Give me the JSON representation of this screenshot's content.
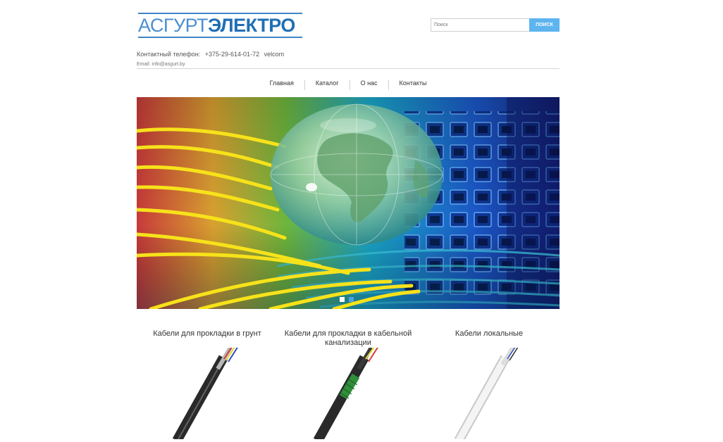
{
  "logo": {
    "part1": "АСГУРТ",
    "part2": "ЭЛЕКТРО"
  },
  "search": {
    "placeholder": "Поиск",
    "button": "ПОИСК"
  },
  "contacts": {
    "phone_label": "Контактный телефон:",
    "phone": "+375-29-614-01-72",
    "operator": "velcom",
    "email": "Email: info@asgurt.by"
  },
  "nav": {
    "items": [
      "Главная",
      "Каталог",
      "О нас",
      "Контакты"
    ]
  },
  "slider": {
    "slide_count": 2,
    "active_index": 1,
    "active_color": "#4aa3e0",
    "inactive_color": "#ffffff"
  },
  "products": [
    {
      "title": "Кабели для прокладки в грунт",
      "icon": "black-armored-cable"
    },
    {
      "title": "Кабели для прокладки в кабельной канализации",
      "icon": "black-cable-green-armor"
    },
    {
      "title": "Кабели локальные",
      "icon": "white-cable"
    }
  ],
  "colors": {
    "brand_light": "#4a8fd0",
    "brand_dark": "#1f6fb5",
    "search_button": "#5db4ef"
  }
}
